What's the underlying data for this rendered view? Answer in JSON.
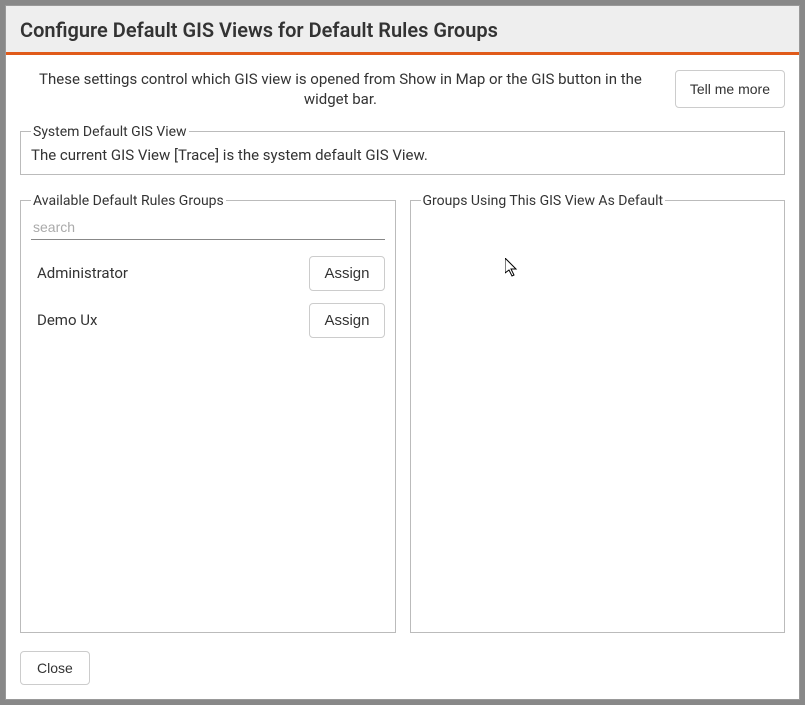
{
  "dialog": {
    "title": "Configure Default GIS Views for Default Rules Groups",
    "description": "These settings control which GIS view is opened from Show in Map or the GIS button in the widget bar.",
    "tell_me_more_label": "Tell me more",
    "close_label": "Close"
  },
  "system_default": {
    "legend": "System Default GIS View",
    "text": "The current GIS View [Trace] is the system default GIS View."
  },
  "available": {
    "legend": "Available Default Rules Groups",
    "search_placeholder": "search",
    "assign_label": "Assign",
    "groups": [
      {
        "name": "Administrator"
      },
      {
        "name": "Demo Ux"
      }
    ]
  },
  "assigned": {
    "legend": "Groups Using This GIS View As Default"
  }
}
